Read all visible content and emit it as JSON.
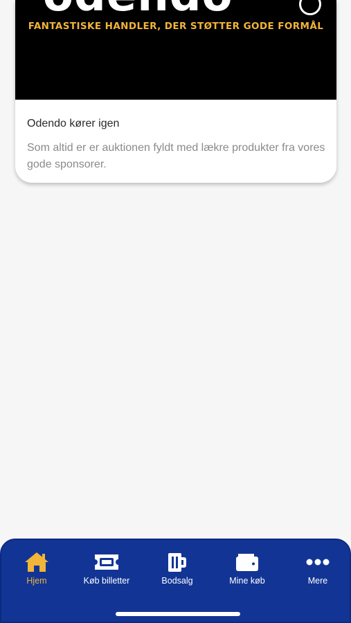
{
  "card": {
    "banner": {
      "logo_text": "odendo",
      "tagline": "FANTASTISKE HANDLER, DER STØTTER GODE FORMÅL"
    },
    "title": "Odendo kører igen",
    "text": "Som altid er er auktionen fyldt med lækre produkter fra vores gode sponsorer."
  },
  "tabbar": {
    "items": [
      {
        "label": "Hjem",
        "icon": "home-icon",
        "active": true
      },
      {
        "label": "Køb billetter",
        "icon": "ticket-icon",
        "active": false
      },
      {
        "label": "Bodsalg",
        "icon": "beer-mug-icon",
        "active": false
      },
      {
        "label": "Mine køb",
        "icon": "wallet-icon",
        "active": false
      },
      {
        "label": "Mere",
        "icon": "more-icon",
        "active": false
      }
    ]
  },
  "colors": {
    "tabbar_bg": "#123595",
    "accent": "#f2b53a",
    "page_bg": "#f6f6f6"
  }
}
